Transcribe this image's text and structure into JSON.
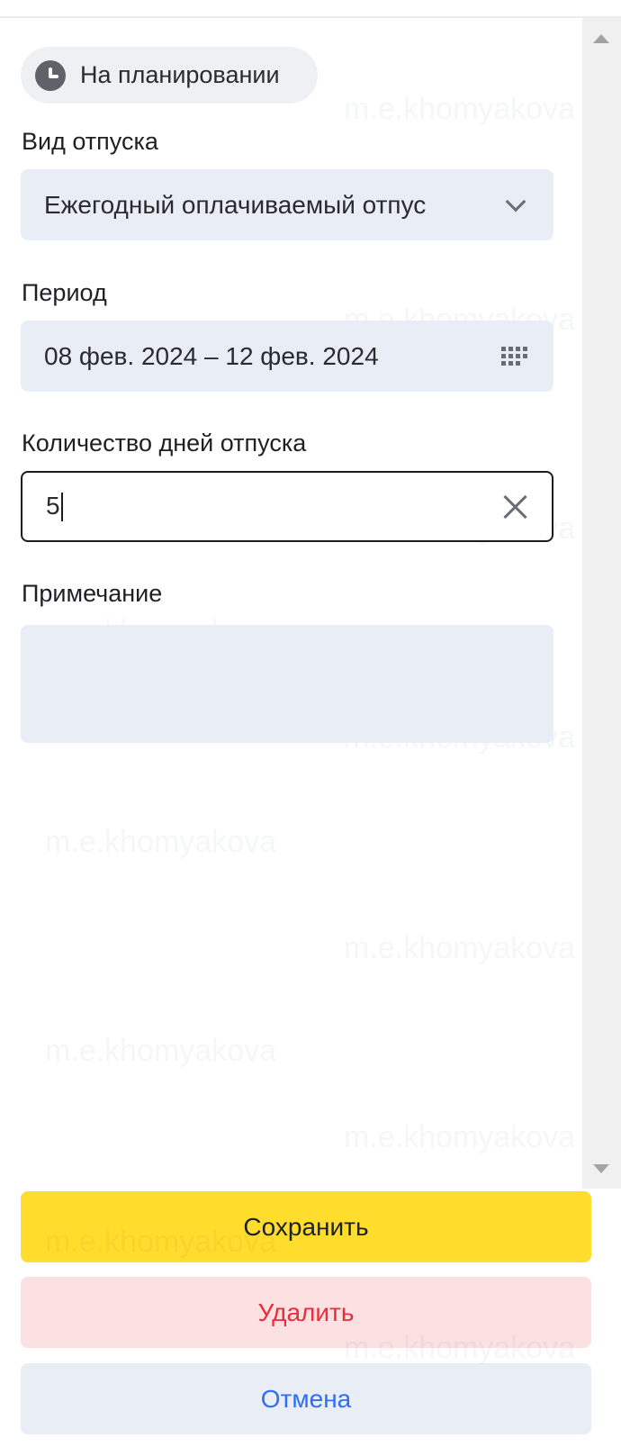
{
  "status": {
    "label": "На планировании",
    "icon": "clock-icon"
  },
  "leave_type": {
    "label": "Вид отпуска",
    "value": "Ежегодный оплачиваемый отпус",
    "icon": "chevron-down-icon"
  },
  "period": {
    "label": "Период",
    "value": "08 фев. 2024 – 12 фев. 2024",
    "icon": "calendar-icon"
  },
  "days_count": {
    "label": "Количество дней отпуска",
    "value": "5",
    "icon": "clear-icon"
  },
  "note": {
    "label": "Примечание",
    "value": ""
  },
  "actions": {
    "save_label": "Сохранить",
    "delete_label": "Удалить",
    "cancel_label": "Отмена"
  },
  "watermark_text": "m.e.khomyakova",
  "colors": {
    "save_button": "#ffdd2d",
    "delete_button_bg": "#fbe1e2",
    "delete_text": "#ea2d3a",
    "cancel_text": "#2f6df6",
    "field_bg": "#e9eef6"
  }
}
